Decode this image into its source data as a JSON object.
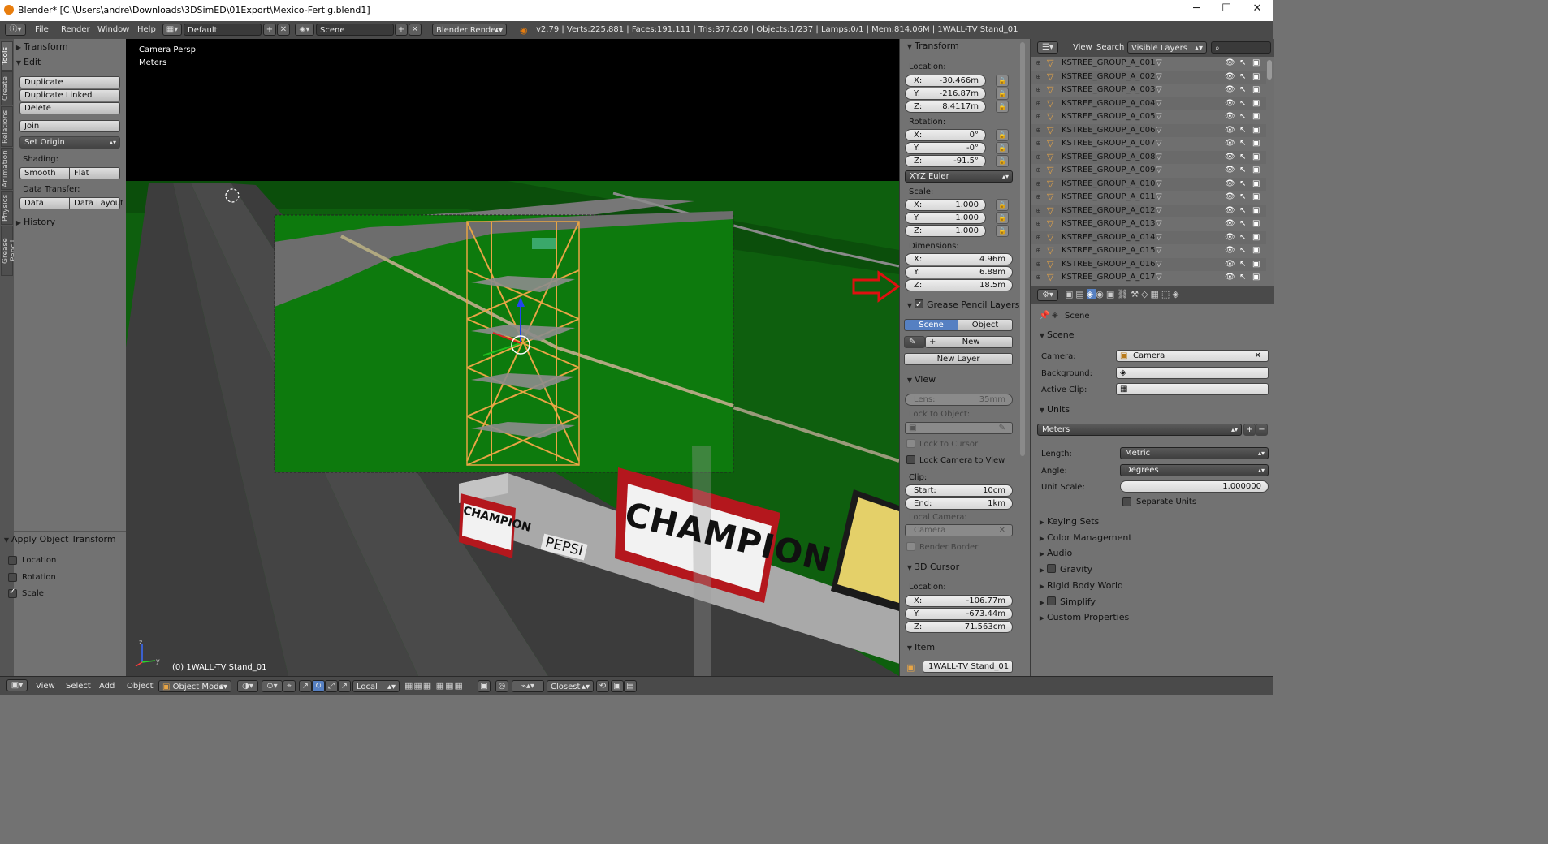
{
  "window": {
    "title": "Blender* [C:\\Users\\andre\\Downloads\\3DSimED\\01Export\\Mexico-Fertig.blend1]",
    "minimize": "─",
    "maximize": "☐",
    "close": "✕"
  },
  "header": {
    "menus": [
      "File",
      "Render",
      "Window",
      "Help"
    ],
    "screen": "Default",
    "scene": "Scene",
    "engine": "Blender Render",
    "stats": "v2.79 | Verts:225,881 | Faces:191,111 | Tris:377,020 | Objects:1/237 | Lamps:0/1 | Mem:814.06M | 1WALL-TV Stand_01"
  },
  "tool_tabs": [
    "Tools",
    "Create",
    "Relations",
    "Animation",
    "Physics",
    "Grease Pencil"
  ],
  "tool_shelf": {
    "transform": "Transform",
    "edit": "Edit",
    "duplicate": "Duplicate",
    "duplicate_linked": "Duplicate Linked",
    "delete": "Delete",
    "join": "Join",
    "set_origin": "Set Origin",
    "shading": "Shading:",
    "smooth": "Smooth",
    "flat": "Flat",
    "data_transfer": "Data Transfer:",
    "data": "Data",
    "data_layout": "Data Layout",
    "history": "History",
    "apply_title": "Apply Object Transform",
    "apply_location": "Location",
    "apply_rotation": "Rotation",
    "apply_scale": "Scale"
  },
  "viewport": {
    "view_name": "Camera Persp",
    "units": "Meters",
    "object_label": "(0) 1WALL-TV Stand_01",
    "signs": {
      "champion_big": "CHAMPION",
      "champion_small": "CHAMPION",
      "pepsi": "PEPSI"
    },
    "colors": {
      "grass": "#0d6e0d",
      "sky": "#000000",
      "road": "#4a4a4a",
      "tower": "#e8a545"
    }
  },
  "npanel": {
    "transform": "Transform",
    "location": "Location:",
    "loc": [
      "-30.466m",
      "-216.87m",
      "8.4117m"
    ],
    "rotation": "Rotation:",
    "rot": [
      "0°",
      "-0°",
      "-91.5°"
    ],
    "rot_mode": "XYZ Euler",
    "scale": "Scale:",
    "scl": [
      "1.000",
      "1.000",
      "1.000"
    ],
    "dimensions": "Dimensions:",
    "dim": [
      "4.96m",
      "6.88m",
      "18.5m"
    ],
    "axes": [
      "X:",
      "Y:",
      "Z:"
    ],
    "gp_layers": "Grease Pencil Layers",
    "gp_scene": "Scene",
    "gp_object": "Object",
    "gp_new": "New",
    "gp_new_layer": "New Layer",
    "view": "View",
    "lens": "Lens:",
    "lens_val": "35mm",
    "lock_to_object": "Lock to Object:",
    "lock_to_cursor": "Lock to Cursor",
    "lock_camera": "Lock Camera to View",
    "clip": "Clip:",
    "clip_start": "Start:",
    "clip_start_val": "10cm",
    "clip_end": "End:",
    "clip_end_val": "1km",
    "local_camera": "Local Camera:",
    "local_camera_val": "Camera",
    "render_border": "Render Border",
    "cursor": "3D Cursor",
    "cursor_location": "Location:",
    "cur": [
      "-106.77m",
      "-673.44m",
      "71.563cm"
    ],
    "item": "Item",
    "item_name": "1WALL-TV Stand_01"
  },
  "outliner": {
    "view": "View",
    "search": "Search",
    "display": "Visible Layers",
    "items": [
      "KSTREE_GROUP_A_001",
      "KSTREE_GROUP_A_002",
      "KSTREE_GROUP_A_003",
      "KSTREE_GROUP_A_004",
      "KSTREE_GROUP_A_005",
      "KSTREE_GROUP_A_006",
      "KSTREE_GROUP_A_007",
      "KSTREE_GROUP_A_008",
      "KSTREE_GROUP_A_009",
      "KSTREE_GROUP_A_010",
      "KSTREE_GROUP_A_011",
      "KSTREE_GROUP_A_012",
      "KSTREE_GROUP_A_013",
      "KSTREE_GROUP_A_014",
      "KSTREE_GROUP_A_015",
      "KSTREE_GROUP_A_016",
      "KSTREE_GROUP_A_017"
    ]
  },
  "properties": {
    "breadcrumb": "Scene",
    "scene": "Scene",
    "camera": "Camera:",
    "camera_val": "Camera",
    "background": "Background:",
    "active_clip": "Active Clip:",
    "units": "Units",
    "unit_preset": "Meters",
    "length": "Length:",
    "length_val": "Metric",
    "angle": "Angle:",
    "angle_val": "Degrees",
    "unit_scale": "Unit Scale:",
    "unit_scale_val": "1.000000",
    "separate_units": "Separate Units",
    "sections": [
      "Keying Sets",
      "Color Management",
      "Audio",
      "Gravity",
      "Rigid Body World",
      "Simplify",
      "Custom Properties"
    ]
  },
  "bottombar": {
    "view": "View",
    "select": "Select",
    "add": "Add",
    "object": "Object",
    "mode": "Object Mode",
    "orientation": "Local",
    "snap": "Closest"
  },
  "accent": {
    "selected_blue": "#5680c2",
    "arrow_red": "#e01010"
  }
}
